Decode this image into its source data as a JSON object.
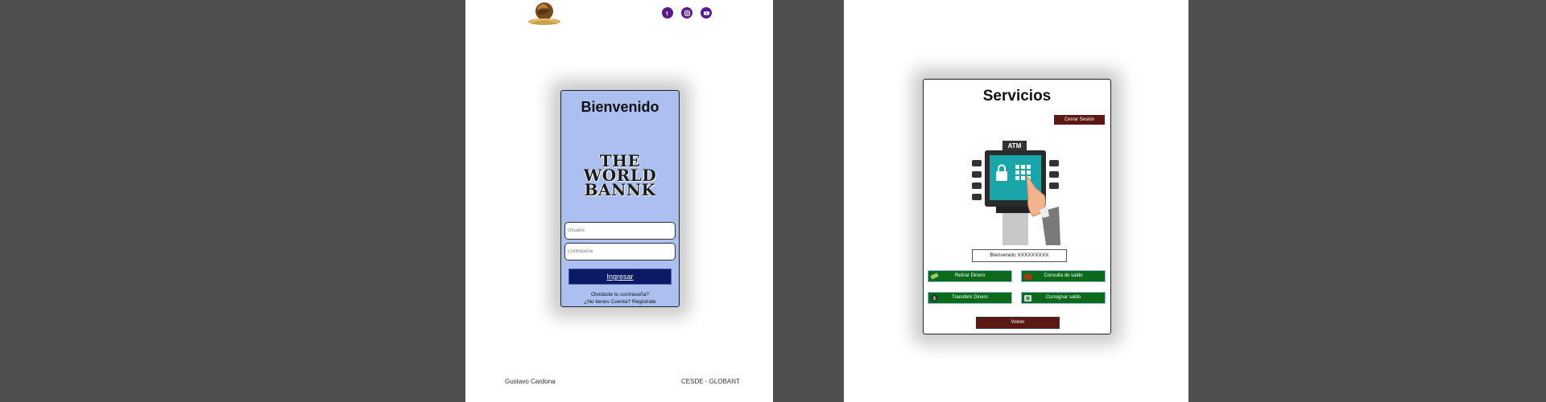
{
  "login": {
    "title": "Bienvenido",
    "brand_line1": "THE WORLD",
    "brand_line2": "BANNK",
    "username_placeholder": "Usuario",
    "password_placeholder": "Contraseña",
    "submit_label": "Ingresar",
    "forgot_label": "Olvidaste tu contraseña?",
    "register_label": "¿No tienes Cuenta? Registrate"
  },
  "footer": {
    "author": "Gustavo Cardona",
    "org": "CESDE - GLOBANT"
  },
  "social": [
    "tumblr-icon",
    "instagram-icon",
    "youtube-icon"
  ],
  "services": {
    "title": "Servicios",
    "logout_label": "Cerrar Sesión",
    "atm_label": "ATM",
    "welcome_text": "Bienvenido XXXXXXXXX",
    "withdraw_label": "Retirar Dinero",
    "balance_label": "Consulta de saldo",
    "transfer_label": "Transferir Dinero",
    "deposit_label": "Consignar saldo",
    "back_label": "Volver"
  },
  "colors": {
    "background": "#4f4f4e",
    "card": "#abbff0",
    "primary_button": "#0c1a66",
    "service_button": "#0b6b1a",
    "danger_button": "#5c1812",
    "social": "#5a1a8a"
  }
}
